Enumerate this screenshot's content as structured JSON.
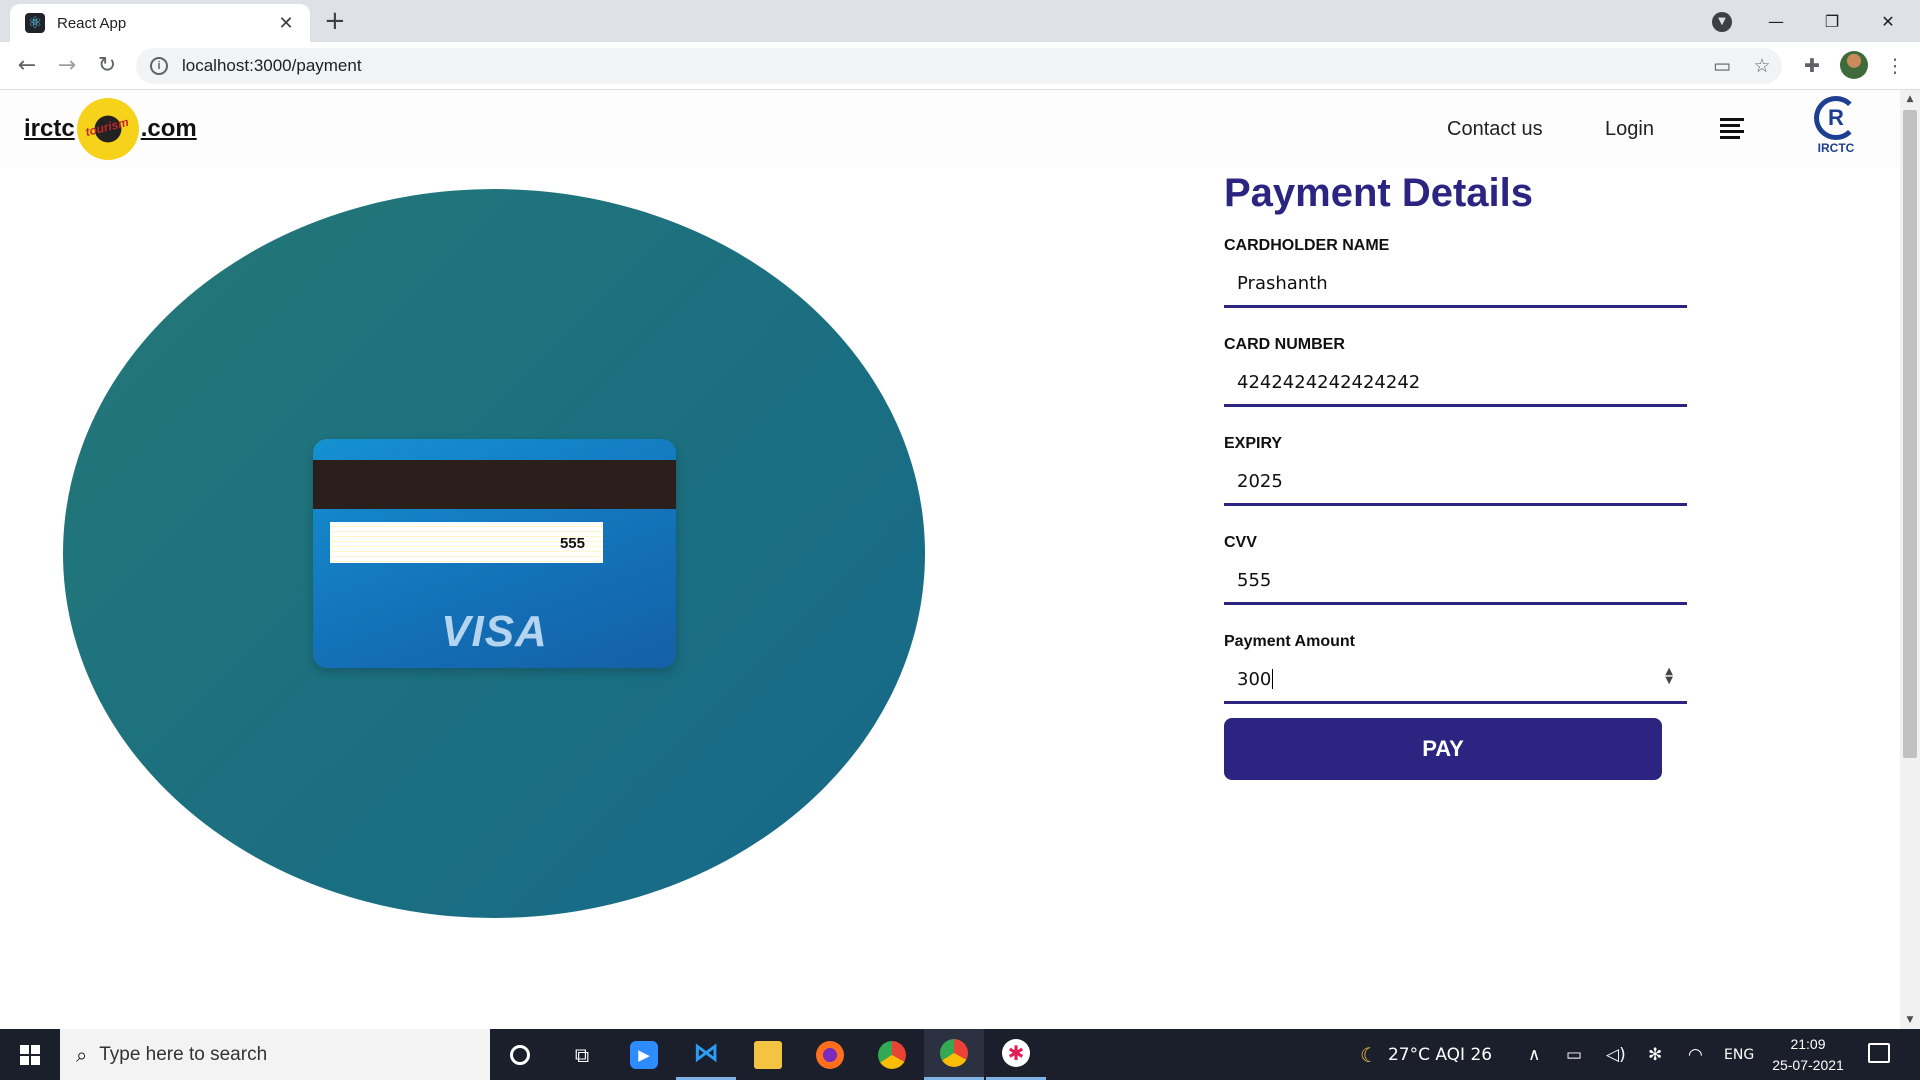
{
  "browser": {
    "tab_title": "React App",
    "tab_close_icon": "close-icon",
    "new_tab_label": "+",
    "url": "localhost:3000/payment",
    "window_controls": [
      "minimize",
      "maximize",
      "close"
    ]
  },
  "navbar": {
    "logo_left": "irctc",
    "logo_right": ".com",
    "logo_script": "tourism",
    "links": [
      "Contact us",
      "Login"
    ],
    "brand_mark": "R",
    "brand_label": "IRCTC"
  },
  "card": {
    "cvv": "555",
    "network": "VISA"
  },
  "form": {
    "title": "Payment Details",
    "fields": [
      {
        "label": "CARDHOLDER NAME",
        "value": "Prashanth"
      },
      {
        "label": "CARD NUMBER",
        "value": "4242424242424242"
      },
      {
        "label": "EXPIRY",
        "value": "2025"
      },
      {
        "label": "CVV",
        "value": "555"
      },
      {
        "label": "Payment Amount",
        "value": "300"
      }
    ],
    "submit_label": "PAY"
  },
  "taskbar": {
    "search_placeholder": "Type here to search",
    "weather": "27°C  AQI 26",
    "language": "ENG",
    "time": "21:09",
    "date": "25-07-2021"
  },
  "colors": {
    "accent": "#2b2480",
    "blob": "#1b6f80",
    "card": "#1371b8"
  }
}
